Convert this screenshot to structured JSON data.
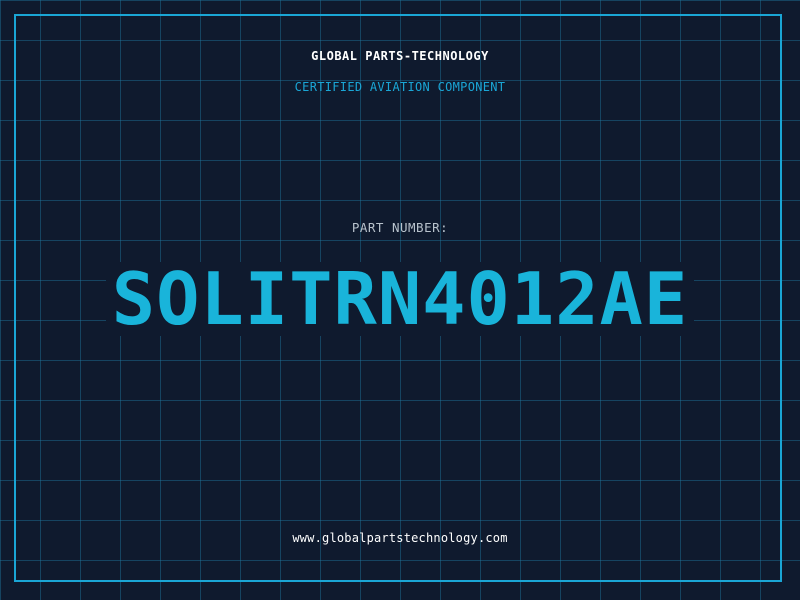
{
  "header": {
    "company_name": "GLOBAL PARTS-TECHNOLOGY",
    "tagline": "CERTIFIED AVIATION COMPONENT"
  },
  "part": {
    "label": "PART NUMBER:",
    "number": "SOLITRN4012AE"
  },
  "footer": {
    "website": "www.globalpartstechnology.com"
  },
  "colors": {
    "background": "#0f1a2e",
    "accent": "#1aa6d6",
    "grid": "#2078a0",
    "text_primary": "#ffffff",
    "text_muted": "#b8c2cc"
  }
}
